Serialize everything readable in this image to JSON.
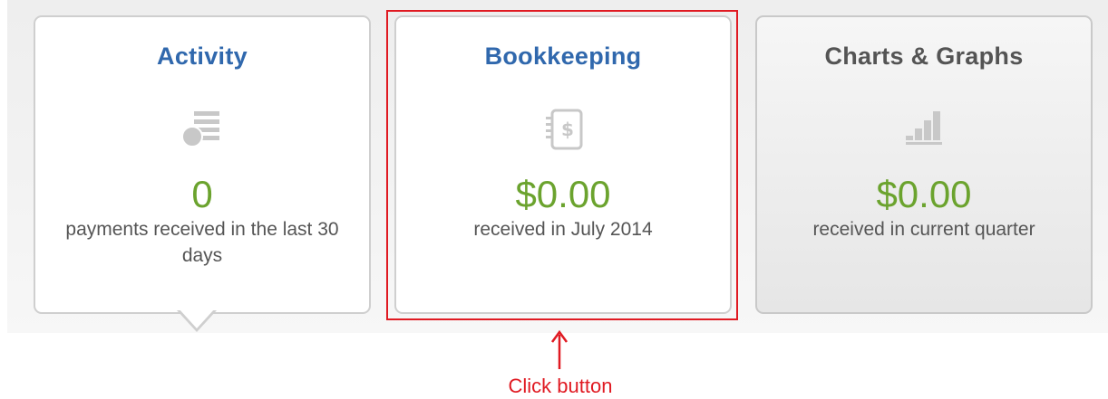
{
  "cards": [
    {
      "title": "Activity",
      "value": "0",
      "caption": "payments received in the last 30 days",
      "icon": "activity-list-icon"
    },
    {
      "title": "Bookkeeping",
      "value": "$0.00",
      "caption": "received in July 2014",
      "icon": "ledger-dollar-icon"
    },
    {
      "title": "Charts & Graphs",
      "value": "$0.00",
      "caption": "received in current quarter",
      "icon": "bar-chart-icon"
    }
  ],
  "annotation": {
    "label": "Click button",
    "color": "#e01a22"
  },
  "colors": {
    "title_blue": "#3068ad",
    "title_dark": "#545454",
    "value_green": "#6ba32e",
    "icon_grey": "#c8c8c8"
  }
}
